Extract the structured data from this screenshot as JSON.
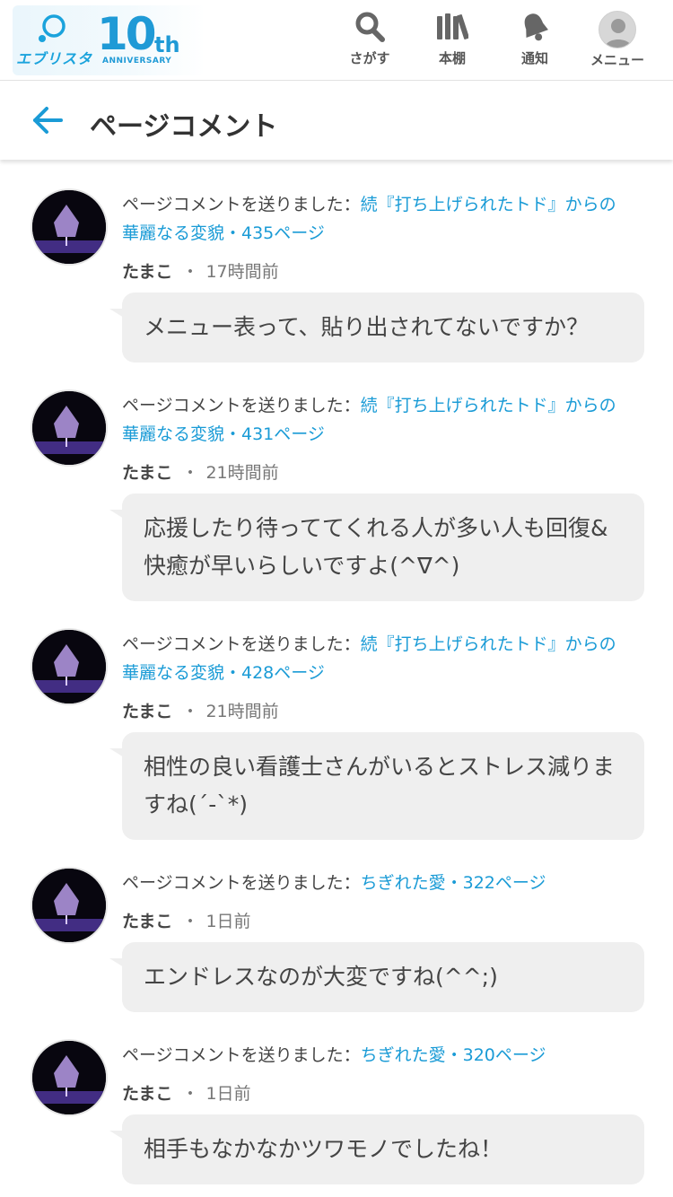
{
  "header": {
    "logo": {
      "brand": "エブリスタ",
      "ten": "10",
      "th": "th",
      "anniversary": "ANNIVERSARY"
    },
    "nav": [
      {
        "label": "さがす",
        "icon": "search-icon"
      },
      {
        "label": "本棚",
        "icon": "bookshelf-icon"
      },
      {
        "label": "通知",
        "icon": "bell-icon"
      },
      {
        "label": "メニュー",
        "icon": "user-avatar-icon"
      }
    ]
  },
  "titlebar": {
    "title": "ページコメント",
    "back_icon": "arrow-left-icon"
  },
  "comments": [
    {
      "prefix": "ページコメントを送りました：",
      "link": "続『打ち上げられたトド』からの華麗なる変貌・435ページ",
      "user": "たまこ",
      "time": "17時間前",
      "text": "メニュー表って、貼り出されてないですか？"
    },
    {
      "prefix": "ページコメントを送りました：",
      "link": "続『打ち上げられたトド』からの華麗なる変貌・431ページ",
      "user": "たまこ",
      "time": "21時間前",
      "text": "応援したり待っててくれる人が多い人も回復&快癒が早いらしいですよ(^∇^)"
    },
    {
      "prefix": "ページコメントを送りました：",
      "link": "続『打ち上げられたトド』からの華麗なる変貌・428ページ",
      "user": "たまこ",
      "time": "21時間前",
      "text": "相性の良い看護士さんがいるとストレス減りますね(´-`*)"
    },
    {
      "prefix": "ページコメントを送りました：",
      "link": "ちぎれた愛・322ページ",
      "user": "たまこ",
      "time": "1日前",
      "text": "エンドレスなのが大変ですね(^^;)"
    },
    {
      "prefix": "ページコメントを送りました：",
      "link": "ちぎれた愛・320ページ",
      "user": "たまこ",
      "time": "1日前",
      "text": "相手もなかなかツワモノでしたね！"
    }
  ],
  "colors": {
    "accent": "#1a9bd6",
    "bubble": "#efefef",
    "text": "#444444"
  }
}
